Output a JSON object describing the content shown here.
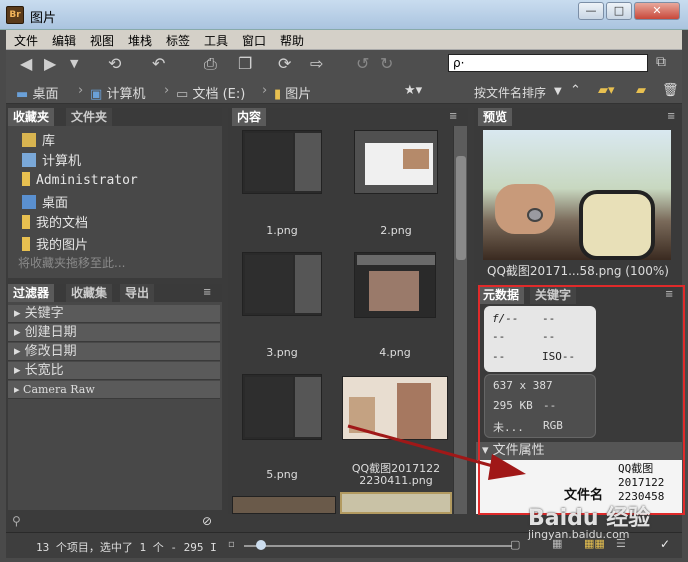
{
  "app": {
    "logo": "Br",
    "title": "图片",
    "min": "—",
    "max": "□",
    "close": "✕"
  },
  "menu": [
    "文件",
    "编辑",
    "视图",
    "堆栈",
    "标签",
    "工具",
    "窗口",
    "帮助"
  ],
  "search": {
    "placeholder": "ρ·"
  },
  "breadcrumb": [
    "桌面",
    "计算机",
    "文档 (E:)",
    "图片"
  ],
  "sort_label": "按文件名排序",
  "favorites": {
    "tab_active": "收藏夹",
    "tab_other": "文件夹",
    "items": [
      "库",
      "计算机",
      "Administrator",
      "桌面",
      "我的文档",
      "我的图片"
    ],
    "hint": "将收藏夹拖移至此..."
  },
  "filters": {
    "tabs": [
      "过滤器",
      "收藏集",
      "导出"
    ],
    "items": [
      "关键字",
      "创建日期",
      "修改日期",
      "长宽比",
      "Camera Raw"
    ]
  },
  "content": {
    "tab": "内容",
    "items": [
      "1.png",
      "2.png",
      "3.png",
      "4.png",
      "5.png",
      "QQ截图20171222230411.png"
    ]
  },
  "content_label_last": [
    "QQ截图2017122",
    "2230411.png"
  ],
  "preview": {
    "tab": "预览",
    "caption": "QQ截图20171...58.png (100%)"
  },
  "metadata": {
    "tabs": [
      "元数据",
      "关键字"
    ],
    "camera": [
      "f/--",
      "--",
      "--",
      "--",
      "--",
      "ISO--"
    ],
    "file": [
      "637 x 387",
      "295 KB",
      "--",
      "未...",
      "RGB"
    ],
    "section": "文件属性",
    "field_label": "文件名",
    "field_value": [
      "QQ截图",
      "2017122",
      "2230458"
    ]
  },
  "status": "13 个项目，选中了 1 个 - 295 I",
  "watermark": "Baidu 经验",
  "watermark_sub": "jingyan.baidu.com"
}
